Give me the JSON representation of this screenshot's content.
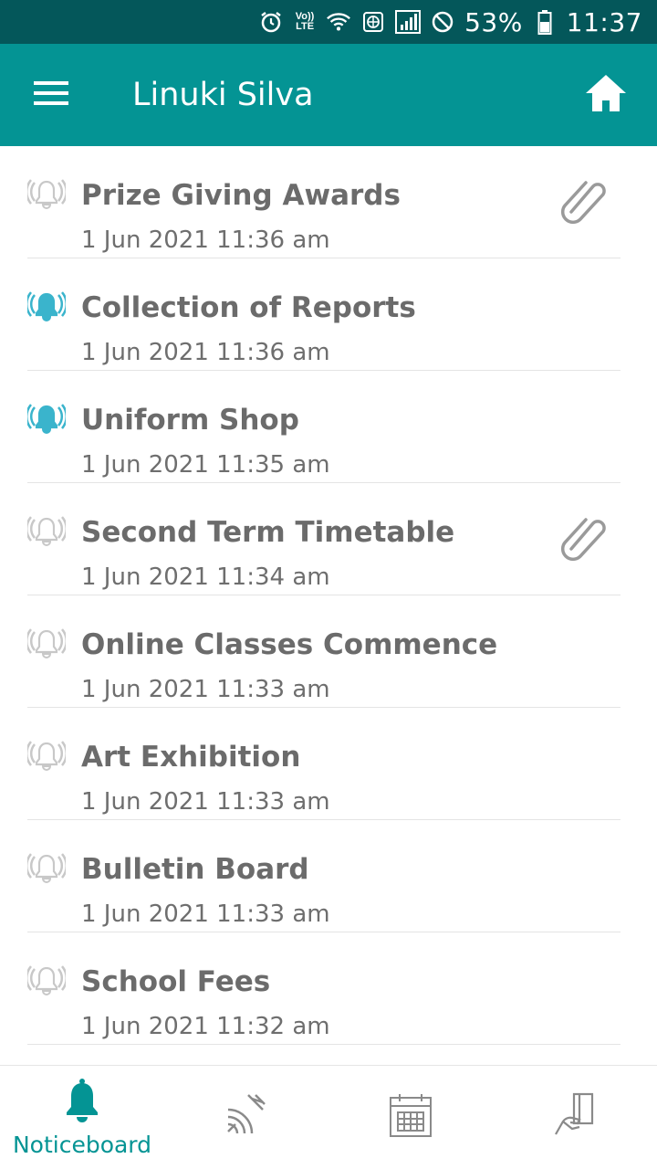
{
  "status_bar": {
    "battery": "53%",
    "time": "11:37",
    "network_label_top": "Vo))",
    "network_label_bottom": "LTE"
  },
  "app_bar": {
    "title": "Linuki Silva",
    "menu_icon": "hamburger-menu-icon",
    "home_icon": "home-icon"
  },
  "notices": [
    {
      "title": "Prize Giving Awards",
      "date": "1 Jun 2021 11:36 am",
      "unread": false,
      "attachment": true
    },
    {
      "title": "Collection of Reports",
      "date": "1 Jun 2021 11:36 am",
      "unread": true,
      "attachment": false
    },
    {
      "title": "Uniform Shop",
      "date": "1 Jun 2021 11:35 am",
      "unread": true,
      "attachment": false
    },
    {
      "title": "Second Term Timetable",
      "date": "1 Jun 2021 11:34 am",
      "unread": false,
      "attachment": true
    },
    {
      "title": "Online Classes Commence",
      "date": "1 Jun 2021 11:33 am",
      "unread": false,
      "attachment": false
    },
    {
      "title": "Art Exhibition",
      "date": "1 Jun 2021 11:33 am",
      "unread": false,
      "attachment": false
    },
    {
      "title": "Bulletin Board",
      "date": "1 Jun 2021 11:33 am",
      "unread": false,
      "attachment": false
    },
    {
      "title": "School Fees",
      "date": "1 Jun 2021 11:32 am",
      "unread": false,
      "attachment": false
    }
  ],
  "bottom_nav": {
    "tabs": [
      {
        "label": "Noticeboard",
        "icon": "bell-icon",
        "active": true
      },
      {
        "label": "",
        "icon": "broadcast-icon",
        "active": false
      },
      {
        "label": "",
        "icon": "calendar-icon",
        "active": false
      },
      {
        "label": "",
        "icon": "card-payment-icon",
        "active": false
      }
    ]
  },
  "colors": {
    "status_bar": "#04575a",
    "app_bar": "#049494",
    "accent": "#049494",
    "unread_bell": "#3ab4cc",
    "read_bell": "#c8c8c8",
    "text": "#6b6b6b"
  }
}
